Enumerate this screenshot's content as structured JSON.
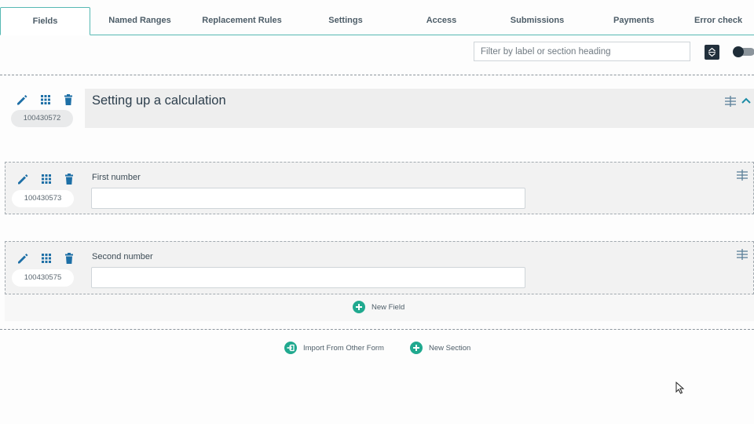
{
  "tabs": [
    {
      "label": "Fields",
      "active": true
    },
    {
      "label": "Named Ranges"
    },
    {
      "label": "Replacement Rules"
    },
    {
      "label": "Settings"
    },
    {
      "label": "Access"
    },
    {
      "label": "Submissions"
    },
    {
      "label": "Payments"
    },
    {
      "label": "Error check"
    }
  ],
  "toolbar": {
    "filter_placeholder": "Filter by label or section heading",
    "sort_icon": "sort-toggle-icon",
    "toggle_icon": "toggle-switch-icon"
  },
  "section": {
    "title": "Setting up a calculation",
    "id": "100430572",
    "icons": [
      "edit-icon",
      "grid-icon",
      "trash-icon",
      "drag-handle-icon",
      "collapse-chevron-icon"
    ]
  },
  "fields": [
    {
      "label": "First number",
      "id": "100430573",
      "value": ""
    },
    {
      "label": "Second number",
      "id": "100430575",
      "value": ""
    }
  ],
  "actions": {
    "new_field": "New Field",
    "import_from_other_form": "Import From Other Form",
    "new_section": "New Section"
  },
  "colors": {
    "accent": "#56b8b3",
    "icon_blue": "#1d6fa6",
    "add_green": "#20a98f",
    "dark": "#22303c"
  }
}
